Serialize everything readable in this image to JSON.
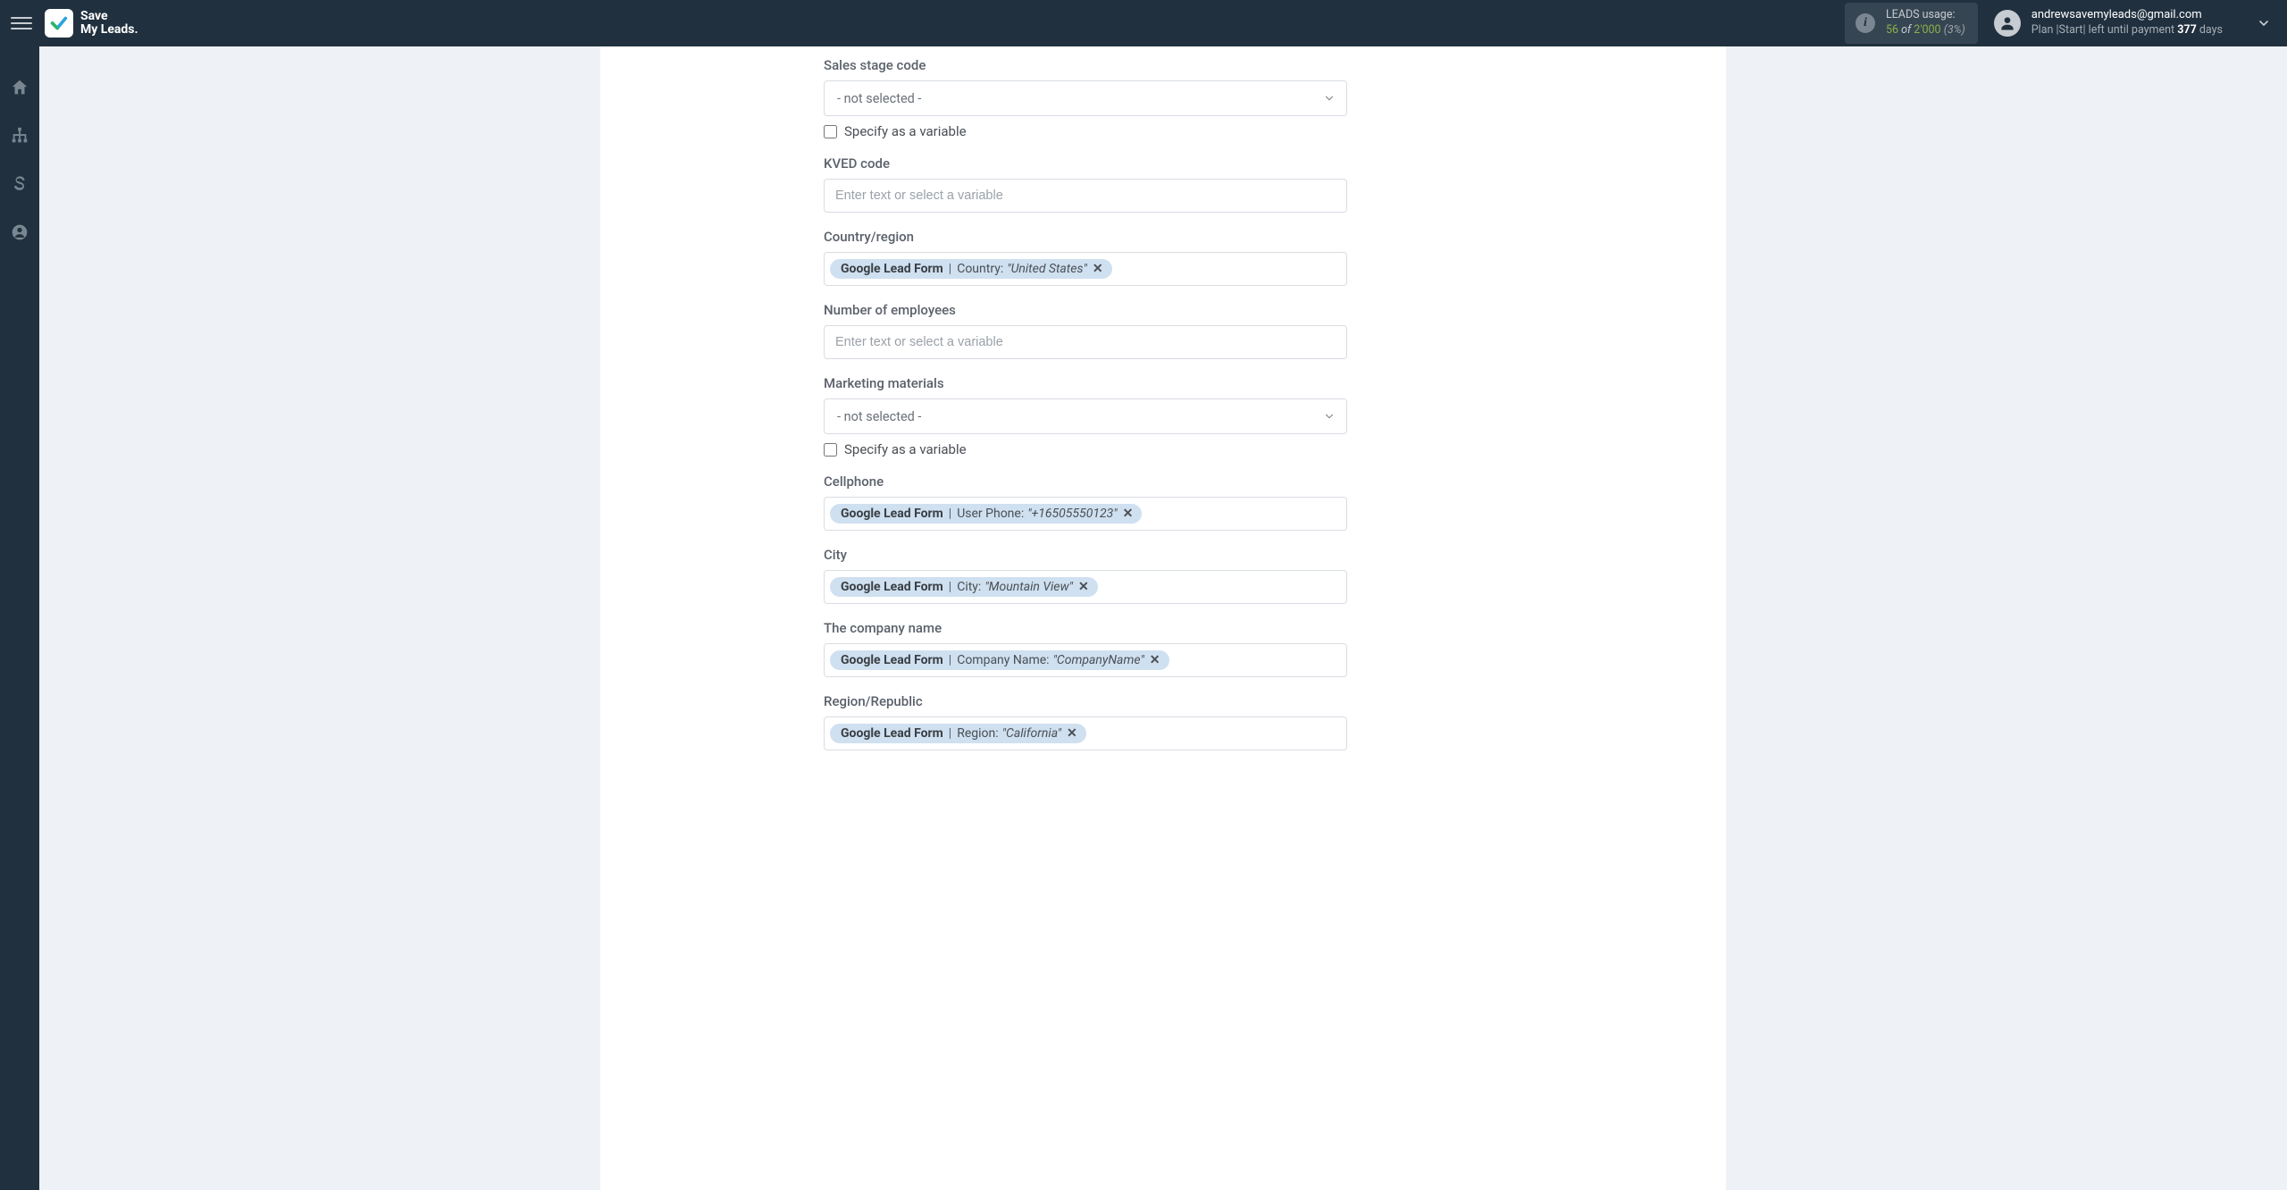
{
  "brand": {
    "line1": "Save",
    "line2": "My Leads."
  },
  "leads": {
    "label": "LEADS usage:",
    "used": "56",
    "sep": " of ",
    "total": "2'000",
    "pct": "(3%)"
  },
  "account": {
    "email": "andrewsavemyleads@gmail.com",
    "plan_prefix": "Plan |Start| left until payment ",
    "days": "377",
    "days_suffix": " days"
  },
  "fields": {
    "sales_stage": {
      "label": "Sales stage code",
      "value": "- not selected -",
      "specify": "Specify as a variable"
    },
    "kved": {
      "label": "KVED code",
      "placeholder": "Enter text or select a variable"
    },
    "country": {
      "label": "Country/region",
      "tag_src": "Google Lead Form",
      "tag_field": " Country: ",
      "tag_val": "\"United States\""
    },
    "employees": {
      "label": "Number of employees",
      "placeholder": "Enter text or select a variable"
    },
    "marketing": {
      "label": "Marketing materials",
      "value": "- not selected -",
      "specify": "Specify as a variable"
    },
    "cellphone": {
      "label": "Cellphone",
      "tag_src": "Google Lead Form",
      "tag_field": " User Phone: ",
      "tag_val": "\"+16505550123\""
    },
    "city": {
      "label": "City",
      "tag_src": "Google Lead Form",
      "tag_field": " City: ",
      "tag_val": "\"Mountain View\""
    },
    "company": {
      "label": "The company name",
      "tag_src": "Google Lead Form",
      "tag_field": " Company Name: ",
      "tag_val": "\"CompanyName\""
    },
    "region": {
      "label": "Region/Republic",
      "tag_src": "Google Lead Form",
      "tag_field": " Region: ",
      "tag_val": "\"California\""
    }
  }
}
